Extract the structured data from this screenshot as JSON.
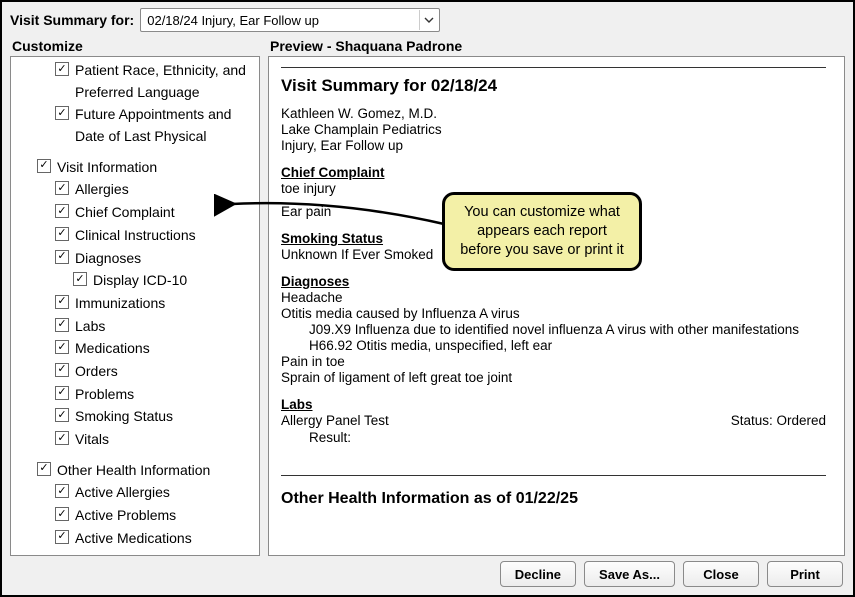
{
  "header": {
    "label": "Visit Summary for:",
    "selected": "02/18/24 Injury, Ear Follow up"
  },
  "customize": {
    "title": "Customize",
    "items": [
      {
        "label": "Patient Race, Ethnicity, and Preferred Language",
        "indent": 2,
        "checked": true,
        "cut": true
      },
      {
        "label": "Future Appointments and Date of Last Physical",
        "indent": 2,
        "checked": true
      },
      {
        "label": "Visit Information",
        "indent": 1,
        "checked": true
      },
      {
        "label": "Allergies",
        "indent": 2,
        "checked": true
      },
      {
        "label": "Chief Complaint",
        "indent": 2,
        "checked": true
      },
      {
        "label": "Clinical Instructions",
        "indent": 2,
        "checked": true
      },
      {
        "label": "Diagnoses",
        "indent": 2,
        "checked": true
      },
      {
        "label": "Display ICD-10",
        "indent": 3,
        "checked": true
      },
      {
        "label": "Immunizations",
        "indent": 2,
        "checked": true
      },
      {
        "label": "Labs",
        "indent": 2,
        "checked": true
      },
      {
        "label": "Medications",
        "indent": 2,
        "checked": true
      },
      {
        "label": "Orders",
        "indent": 2,
        "checked": true
      },
      {
        "label": "Problems",
        "indent": 2,
        "checked": true
      },
      {
        "label": "Smoking Status",
        "indent": 2,
        "checked": true
      },
      {
        "label": "Vitals",
        "indent": 2,
        "checked": true
      },
      {
        "label": "Other Health Information",
        "indent": 1,
        "checked": true
      },
      {
        "label": "Active Allergies",
        "indent": 2,
        "checked": true
      },
      {
        "label": "Active Problems",
        "indent": 2,
        "checked": true
      },
      {
        "label": "Active Medications",
        "indent": 2,
        "checked": true
      }
    ]
  },
  "preview": {
    "header": "Preview - Shaquana Padrone",
    "title": "Visit Summary for 02/18/24",
    "provider": "Kathleen W. Gomez, M.D.",
    "practice": "Lake Champlain Pediatrics",
    "visit_reason": "Injury, Ear Follow up",
    "chief_complaint_head": "Chief Complaint",
    "chief_complaint_lines": [
      "toe injury",
      "Ear pain"
    ],
    "smoking_head": "Smoking Status",
    "smoking_value": "Unknown If Ever Smoked",
    "diagnoses_head": "Diagnoses",
    "diagnoses": [
      "Headache",
      "Otitis media caused by Influenza A virus",
      "J09.X9 Influenza due to identified novel influenza A virus with other manifestations",
      "H66.92 Otitis media, unspecified, left ear",
      "Pain in toe",
      "Sprain of ligament of left great toe joint"
    ],
    "labs_head": "Labs",
    "labs_name": "Allergy Panel Test",
    "labs_status": "Status: Ordered",
    "labs_result": "Result:",
    "other_head": "Other Health Information as of 01/22/25"
  },
  "callout": "You can customize what appears each report before you save or print it",
  "buttons": {
    "decline": "Decline",
    "save_as": "Save As...",
    "close": "Close",
    "print": "Print"
  }
}
